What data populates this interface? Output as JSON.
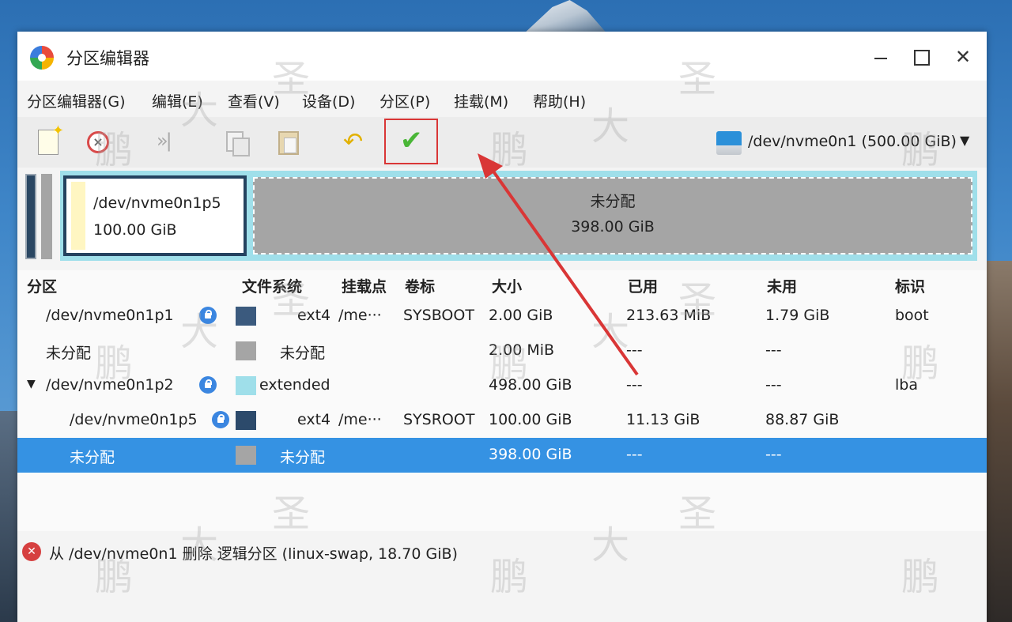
{
  "window": {
    "title": "分区编辑器"
  },
  "menu": [
    "分区编辑器(G)",
    "编辑(E)",
    "查看(V)",
    "设备(D)",
    "分区(P)",
    "挂载(M)",
    "帮助(H)"
  ],
  "toolbar": {
    "icons": [
      "new-icon",
      "delete-icon",
      "resize-icon",
      "copy-icon",
      "paste-icon",
      "undo-icon",
      "apply-icon"
    ],
    "device": "/dev/nvme0n1 (500.00 GiB)"
  },
  "diskmap": {
    "partition": {
      "name": "/dev/nvme0n1p5",
      "size": "100.00 GiB"
    },
    "unallocated": {
      "name": "未分配",
      "size": "398.00 GiB"
    }
  },
  "table": {
    "headers": [
      "分区",
      "文件系统",
      "挂载点",
      "卷标",
      "大小",
      "已用",
      "未用",
      "标识"
    ],
    "rows": [
      {
        "partition": "/dev/nvme0n1p1",
        "fs": "ext4",
        "mount": "/me···",
        "label": "SYSBOOT",
        "size": "2.00 GiB",
        "used": "213.63 MiB",
        "unused": "1.79 GiB",
        "flags": "boot",
        "color": "#3b5a7e"
      },
      {
        "partition": "未分配",
        "fs": "未分配",
        "mount": "",
        "label": "",
        "size": "2.00 MiB",
        "used": "---",
        "unused": "---",
        "flags": "",
        "color": "#a5a5a5"
      },
      {
        "partition": "/dev/nvme0n1p2",
        "fs": "extended",
        "mount": "",
        "label": "",
        "size": "498.00 GiB",
        "used": "---",
        "unused": "---",
        "flags": "lba",
        "color": "#9fdfea"
      },
      {
        "partition": "/dev/nvme0n1p5",
        "fs": "ext4",
        "mount": "/me···",
        "label": "SYSROOT",
        "size": "100.00 GiB",
        "used": "11.13 GiB",
        "unused": "88.87 GiB",
        "flags": "",
        "color": "#2c4a6b"
      },
      {
        "partition": "未分配",
        "fs": "未分配",
        "mount": "",
        "label": "",
        "size": "398.00 GiB",
        "used": "---",
        "unused": "---",
        "flags": "",
        "color": "#a5a5a5"
      }
    ]
  },
  "status": {
    "text": "从 /dev/nvme0n1 删除 逻辑分区 (linux-swap, 18.70 GiB)"
  },
  "watermark": [
    "大",
    "圣",
    "鹏"
  ],
  "colors": {
    "selection": "#3592e3",
    "annotation": "#d93636",
    "apply": "#4ab637"
  }
}
